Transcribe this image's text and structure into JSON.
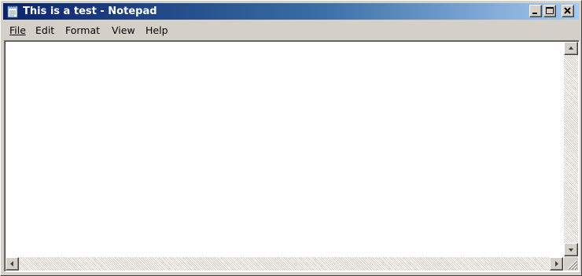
{
  "window": {
    "title": "This is a test - Notepad",
    "app_icon": "notepad-icon",
    "controls": [
      {
        "name": "minimize-button",
        "icon": "minimize-icon"
      },
      {
        "name": "maximize-button",
        "icon": "maximize-icon"
      },
      {
        "name": "close-button",
        "icon": "close-icon"
      }
    ]
  },
  "menu": {
    "file": "File",
    "edit": "Edit",
    "format": "Format",
    "view": "View",
    "help": "Help"
  },
  "editor": {
    "content": ""
  },
  "colors": {
    "titlebar_start": "#0a246a",
    "titlebar_end": "#a6caf0",
    "face": "#d4d0c8",
    "editor_background": "#ffffff"
  }
}
